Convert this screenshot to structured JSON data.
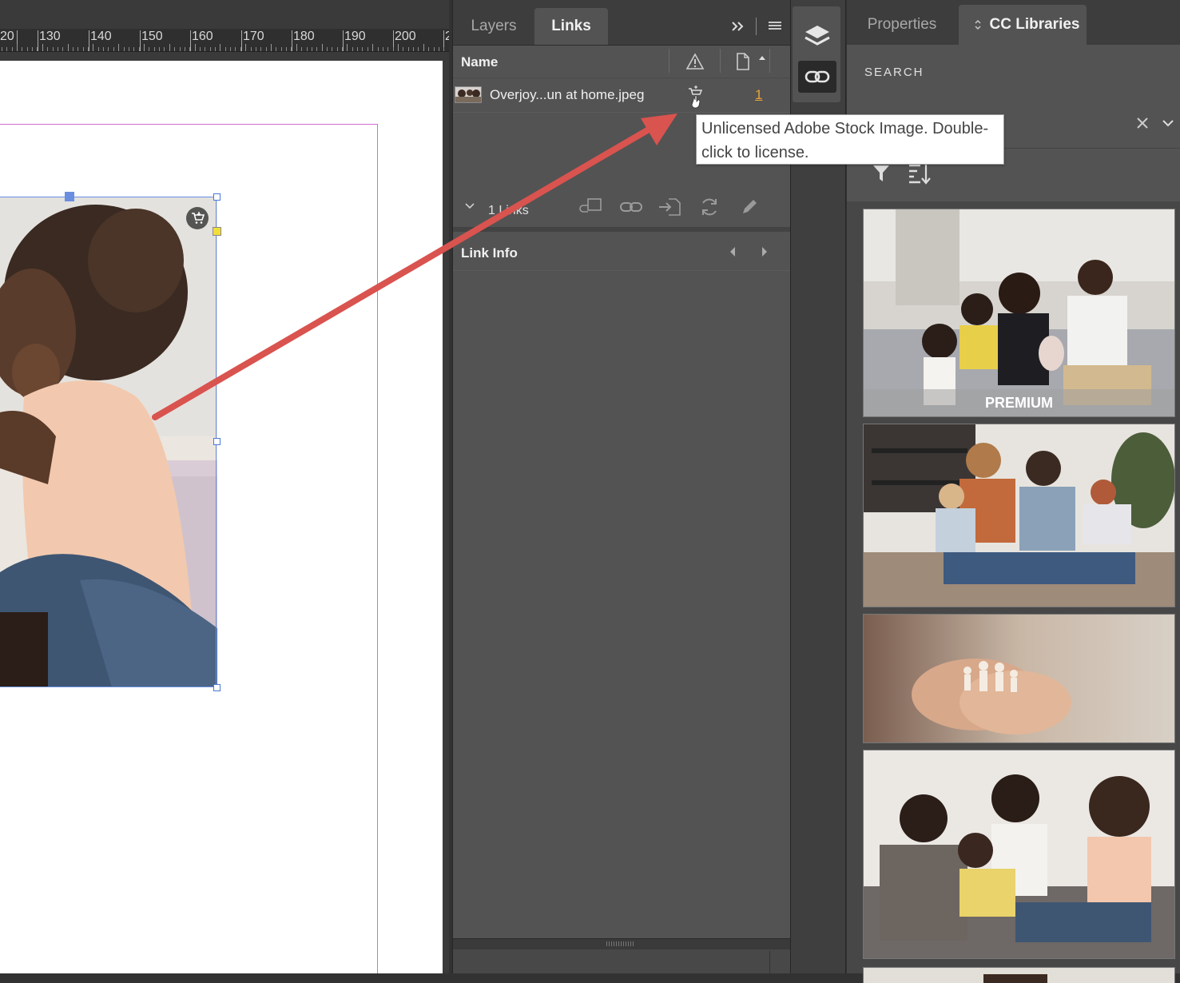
{
  "ruler": {
    "labels": [
      "20",
      "130",
      "140",
      "150",
      "160",
      "170",
      "180",
      "190",
      "200",
      "2"
    ]
  },
  "links_panel": {
    "tabs": [
      {
        "label": "Layers",
        "active": false
      },
      {
        "label": "Links",
        "active": true
      }
    ],
    "column_name": "Name",
    "row": {
      "filename": "Overjoy...un at home.jpeg",
      "page": "1"
    },
    "link_count": "1 Links",
    "link_info": "Link Info"
  },
  "tooltip": {
    "line1": "Unlicensed Adobe Stock Image. Double-",
    "line2": "click to license."
  },
  "cc_panel": {
    "tabs": [
      {
        "label": "Properties",
        "active": false
      },
      {
        "label": "CC Libraries",
        "active": true
      }
    ],
    "search_label": "SEARCH",
    "premium_label": "PREMIUM"
  },
  "colors": {
    "accent_link": "#e8a23a",
    "arrow": "#d9534f",
    "margin_guide": "#d06fd0",
    "frame": "#6b8fe0"
  },
  "icons": [
    "shopping-cart-icon",
    "warning-icon",
    "page-icon",
    "sort-up-icon",
    "expand-panel-icon",
    "panel-menu-icon",
    "layers-icon",
    "link-icon",
    "relink-icon",
    "go-to-link-icon",
    "update-link-icon",
    "edit-original-icon",
    "chevron-down-icon",
    "prev-icon",
    "next-icon",
    "close-icon",
    "filter-icon",
    "sort-icon"
  ]
}
